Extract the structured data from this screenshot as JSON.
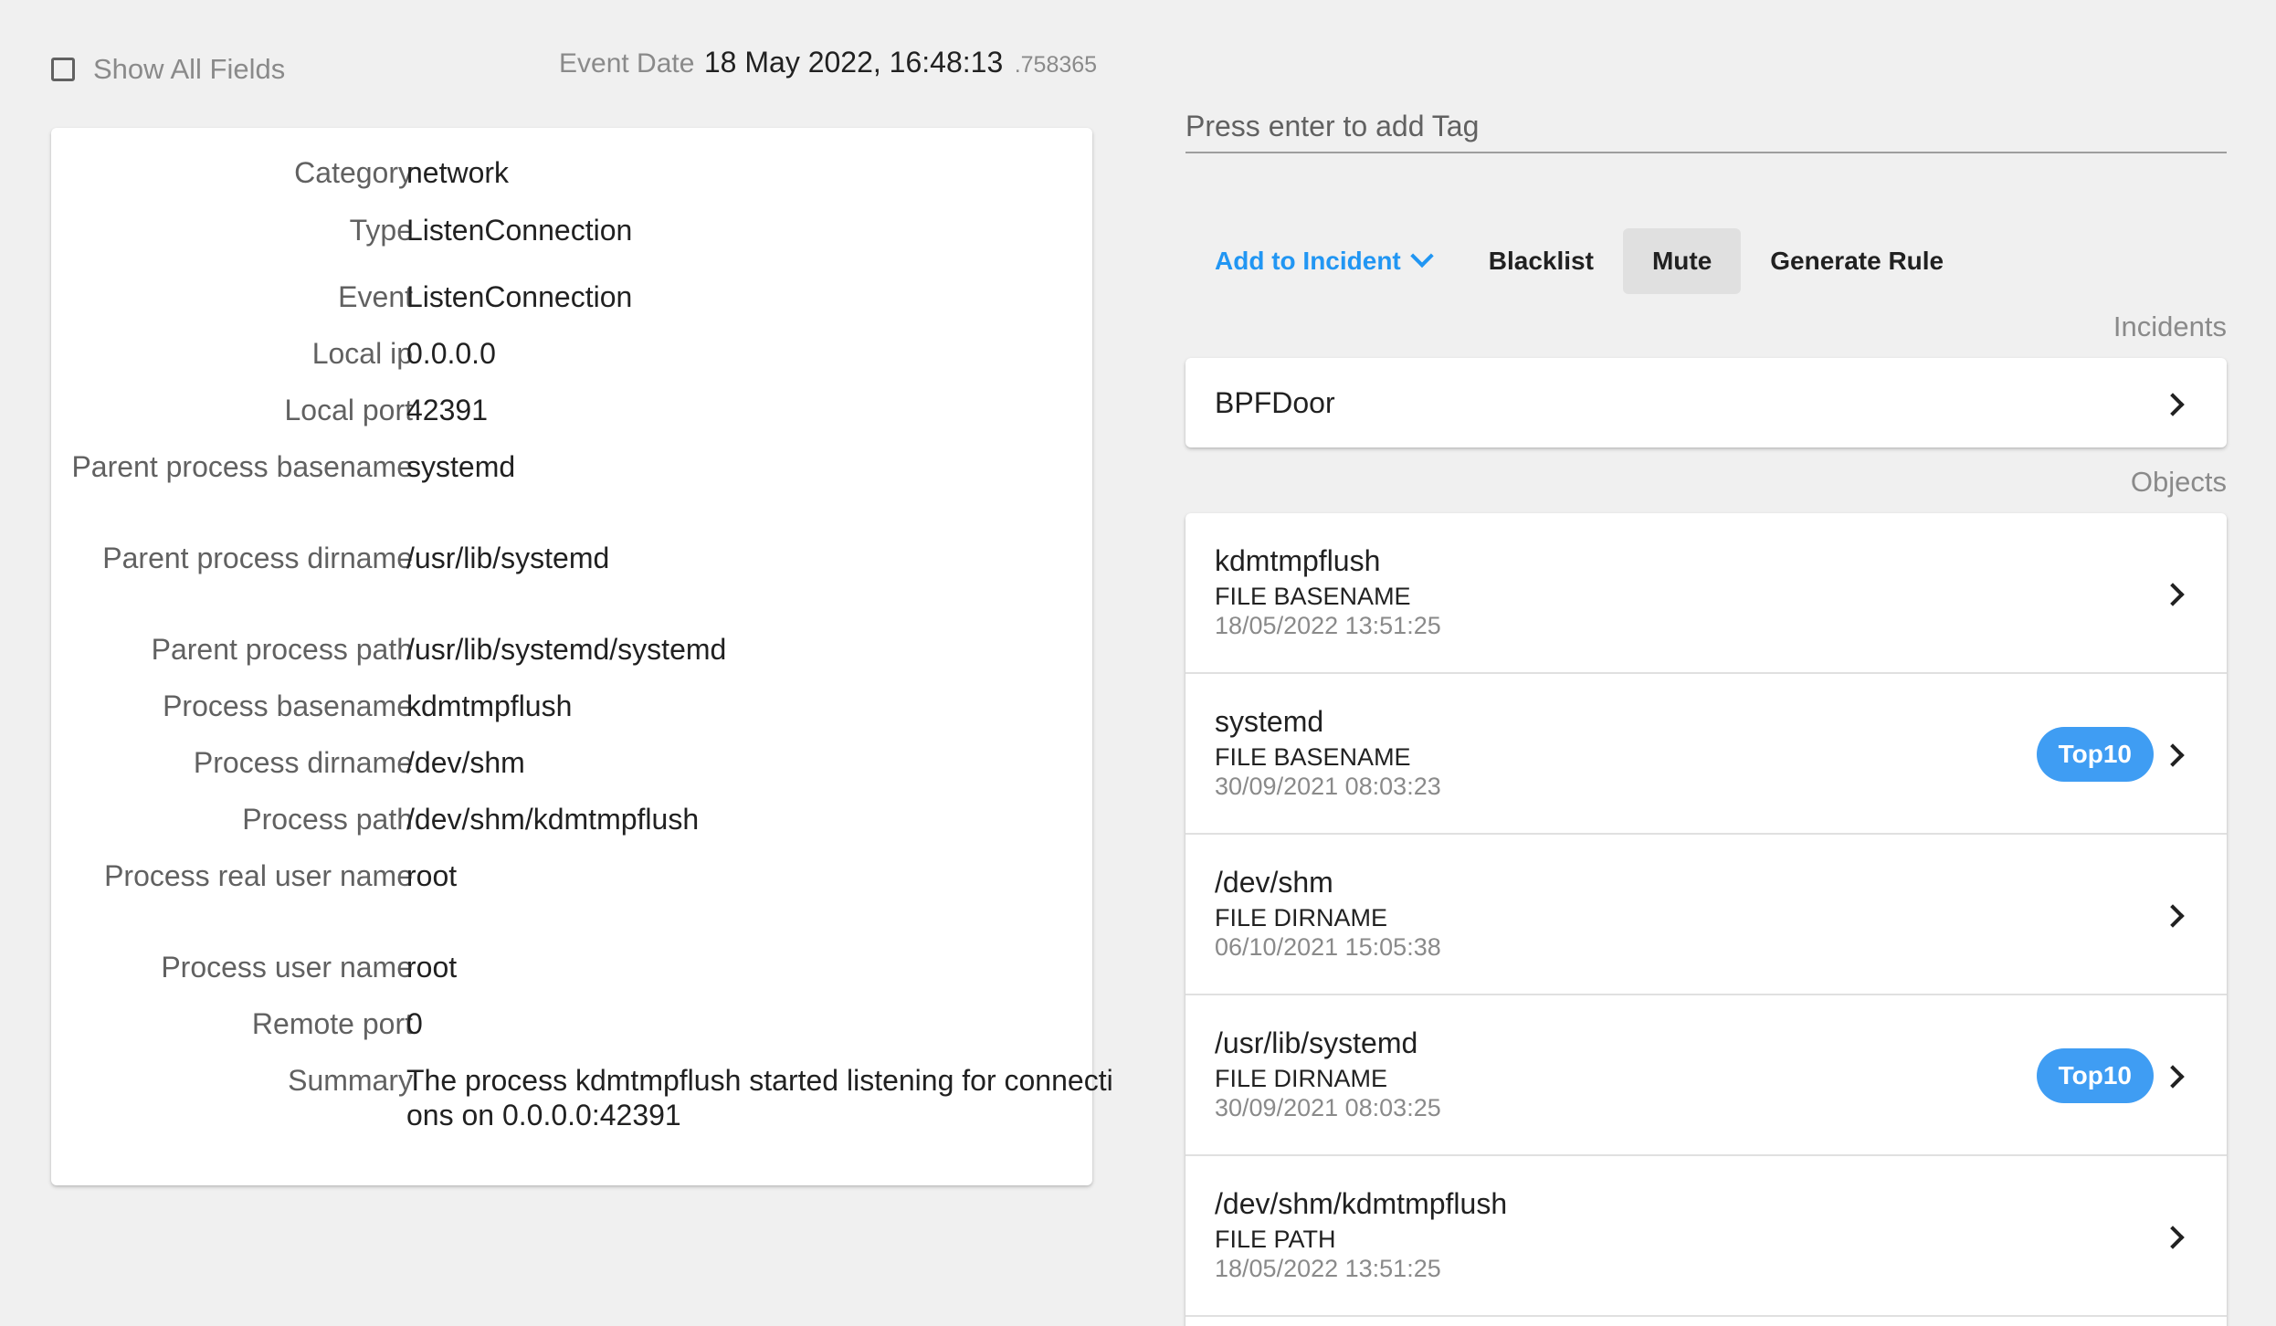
{
  "header": {
    "show_all_fields_label": "Show All Fields",
    "show_all_fields_checked": false,
    "event_date_label": "Event Date",
    "event_date_value": "18 May 2022, 16:48:13",
    "event_date_fraction": ".758365"
  },
  "fields": [
    {
      "label": "Category",
      "value": "network"
    },
    {
      "label": "Type",
      "value": "ListenConnection"
    },
    {
      "label": "Event",
      "value": "ListenConnection"
    },
    {
      "label": "Local ip",
      "value": "0.0.0.0"
    },
    {
      "label": "Local port",
      "value": "42391"
    },
    {
      "label": "Parent process basename",
      "value": "systemd"
    },
    {
      "label": "Parent process dirname",
      "value": "/usr/lib/systemd"
    },
    {
      "label": "Parent process path",
      "value": "/usr/lib/systemd/systemd"
    },
    {
      "label": "Process basename",
      "value": "kdmtmpflush"
    },
    {
      "label": "Process dirname",
      "value": "/dev/shm"
    },
    {
      "label": "Process path",
      "value": "/dev/shm/kdmtmpflush"
    },
    {
      "label": "Process real user name",
      "value": "root"
    },
    {
      "label": "Process user name",
      "value": "root"
    },
    {
      "label": "Remote port",
      "value": "0"
    },
    {
      "label": "Summary",
      "value": "The process kdmtmpflush started listening for connections on 0.0.0.0:42391"
    }
  ],
  "tag_input": {
    "placeholder": "Press enter to add Tag",
    "value": ""
  },
  "actions": {
    "add_to_incident": "Add to Incident",
    "blacklist": "Blacklist",
    "mute": "Mute",
    "generate_rule": "Generate Rule"
  },
  "incidents": {
    "title": "Incidents",
    "items": [
      {
        "name": "BPFDoor"
      }
    ]
  },
  "objects": {
    "title": "Objects",
    "items": [
      {
        "name": "kdmtmpflush",
        "type": "FILE BASENAME",
        "date": "18/05/2022 13:51:25",
        "badge": ""
      },
      {
        "name": "systemd",
        "type": "FILE BASENAME",
        "date": "30/09/2021 08:03:23",
        "badge": "Top10"
      },
      {
        "name": "/dev/shm",
        "type": "FILE DIRNAME",
        "date": "06/10/2021 15:05:38",
        "badge": ""
      },
      {
        "name": "/usr/lib/systemd",
        "type": "FILE DIRNAME",
        "date": "30/09/2021 08:03:25",
        "badge": "Top10"
      },
      {
        "name": "/dev/shm/kdmtmpflush",
        "type": "FILE PATH",
        "date": "18/05/2022 13:51:25",
        "badge": ""
      }
    ]
  },
  "colors": {
    "accent": "#2196f3",
    "badge": "#3f9df3",
    "background": "#f0f0f0"
  }
}
